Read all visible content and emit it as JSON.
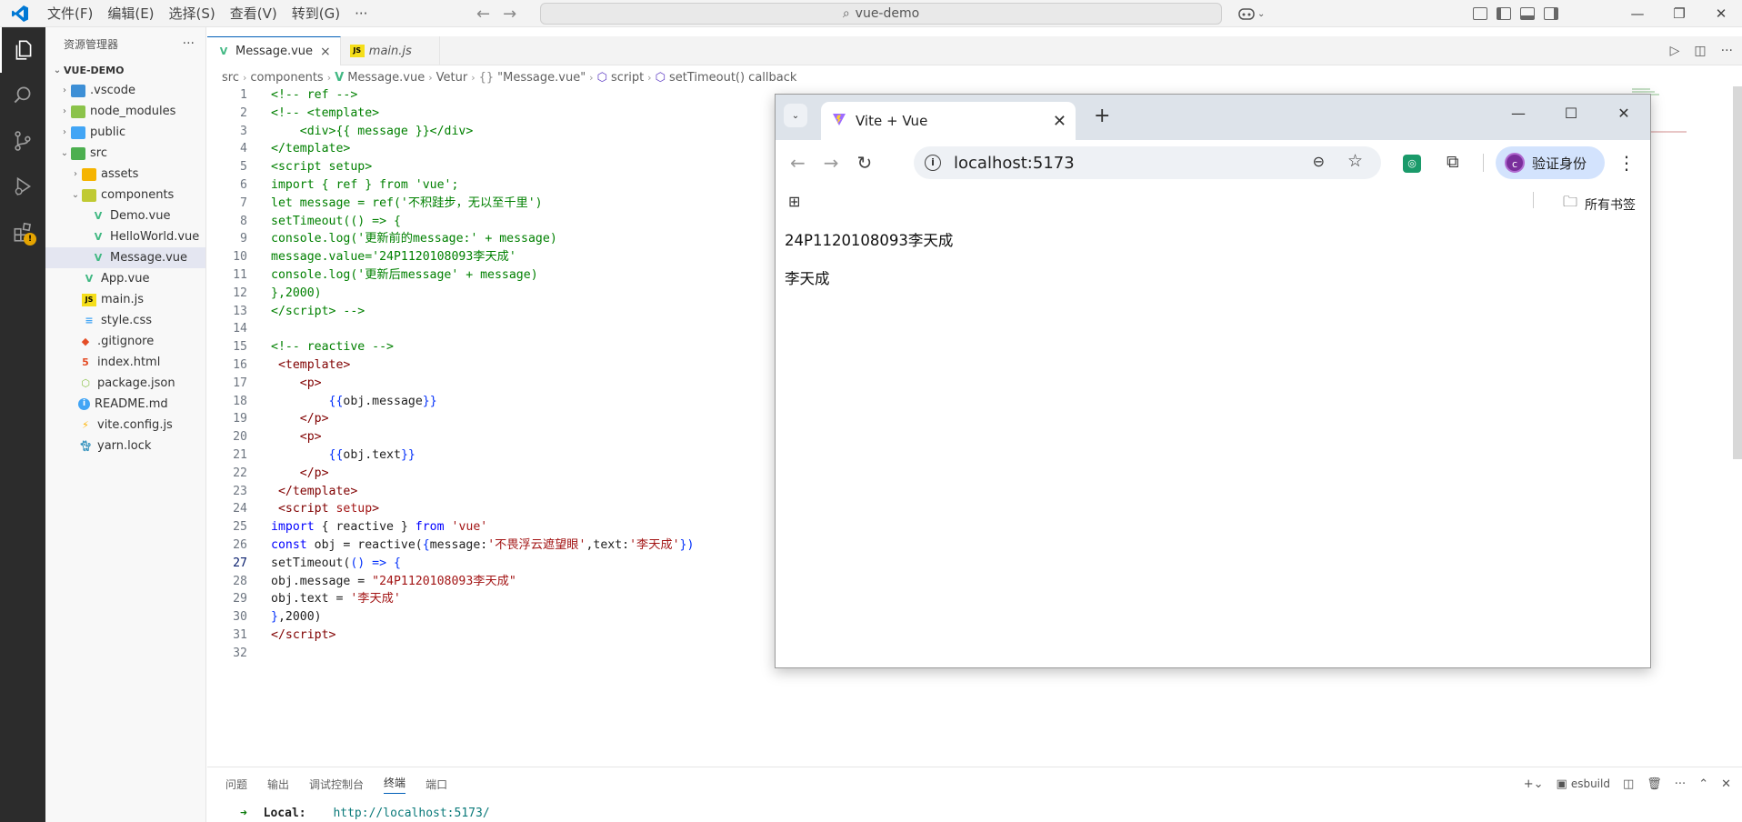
{
  "titlebar": {
    "menu": [
      "文件(F)",
      "编辑(E)",
      "选择(S)",
      "查看(V)",
      "转到(G)",
      "···"
    ],
    "search": "vue-demo"
  },
  "sidebar": {
    "title": "资源管理器",
    "more": "···",
    "root": "VUE-DEMO",
    "items": [
      {
        "label": ".vscode"
      },
      {
        "label": "node_modules"
      },
      {
        "label": "public"
      },
      {
        "label": "src"
      },
      {
        "label": "assets"
      },
      {
        "label": "components"
      },
      {
        "label": "Demo.vue"
      },
      {
        "label": "HelloWorld.vue"
      },
      {
        "label": "Message.vue"
      },
      {
        "label": "App.vue"
      },
      {
        "label": "main.js"
      },
      {
        "label": "style.css"
      },
      {
        "label": ".gitignore"
      },
      {
        "label": "index.html"
      },
      {
        "label": "package.json"
      },
      {
        "label": "README.md"
      },
      {
        "label": "vite.config.js"
      },
      {
        "label": "yarn.lock"
      }
    ]
  },
  "tabs": [
    {
      "label": "Message.vue",
      "close": "×"
    },
    {
      "label": "main.js"
    }
  ],
  "breadcrumb": [
    "src",
    "components",
    "Message.vue",
    "Vetur",
    "\"Message.vue\"",
    "script",
    "setTimeout() callback"
  ],
  "code": {
    "line_numbers": [
      "1",
      "2",
      "3",
      "4",
      "5",
      "6",
      "7",
      "8",
      "9",
      "10",
      "11",
      "12",
      "13",
      "14",
      "15",
      "16",
      "17",
      "18",
      "19",
      "20",
      "21",
      "22",
      "23",
      "24",
      "25",
      "26",
      "27",
      "28",
      "29",
      "30",
      "31",
      "32"
    ]
  },
  "panel": {
    "tabs": [
      "问题",
      "输出",
      "调试控制台",
      "终端",
      "端口"
    ],
    "shell": "esbuild",
    "terminal_label": "Local:",
    "terminal_url": "http://localhost:5173/"
  },
  "browser": {
    "tab_title": "Vite + Vue",
    "url": "localhost:5173",
    "verify": "验证身份",
    "avatar": "c",
    "bookmarks_label": "所有书签",
    "page_lines": [
      "24P1120108093李天成",
      "李天成"
    ]
  }
}
